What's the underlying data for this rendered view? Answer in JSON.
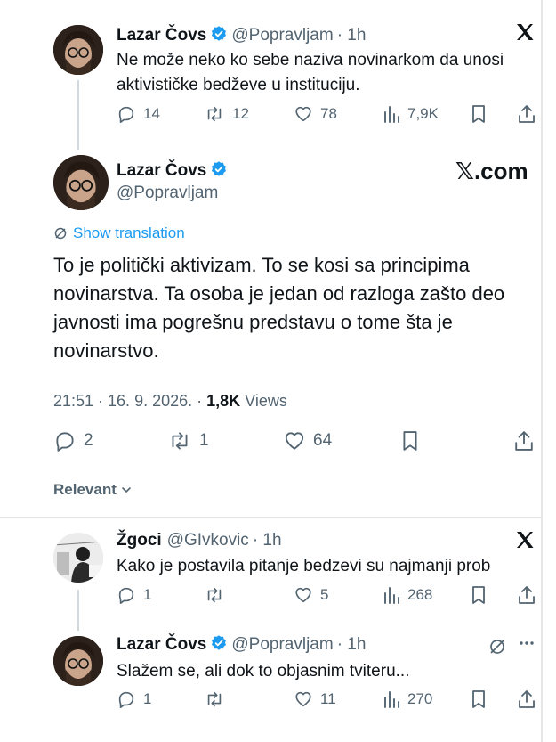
{
  "tweet1": {
    "name": "Lazar Čovs",
    "handle": "@Popravljam",
    "time": "· 1h",
    "text_line1": "Ne može neko ko sebe naziva novinarkom da unosi",
    "text_line2": "aktivističke bedževe u instituciju.",
    "replies": "14",
    "retweets": "12",
    "likes": "78",
    "views": "7,9K"
  },
  "main": {
    "name": "Lazar Čovs",
    "handle": "@Popravljam",
    "site_label": "𝕏.com",
    "translation": "Show translation",
    "text_line1": "To je politički aktivizam. To se kosi sa principima",
    "text_line2": "novinarstva. Ta osoba je jedan od razloga zašto deo",
    "text_line3": "javnosti ima pogrešnu predstavu o tome šta je",
    "text_line4": "novinarstvo.",
    "timestamp": "21:51 · 16. 9. 2026. · ",
    "views_count": "1,8K",
    "views_label": " Views",
    "replies": "2",
    "retweets": "1",
    "likes": "64"
  },
  "filter": {
    "label": "Relevant"
  },
  "reply1": {
    "name": "Žgoci",
    "handle": "@GIvkovic",
    "time": "· 1h",
    "text": "Kako je postavila pitanje bedzevi su najmanji prob",
    "replies": "1",
    "retweets": "",
    "likes": "5",
    "views": "268"
  },
  "reply2": {
    "name": "Lazar Čovs",
    "handle": "@Popravljam",
    "time": "· 1h",
    "text": "Slažem se, ali dok to objasnim tviteru...",
    "replies": "1",
    "retweets": "",
    "likes": "11",
    "views": "270"
  },
  "colors": {
    "accent": "#1d9bf0",
    "muted": "#536471",
    "text": "#0f1419"
  }
}
